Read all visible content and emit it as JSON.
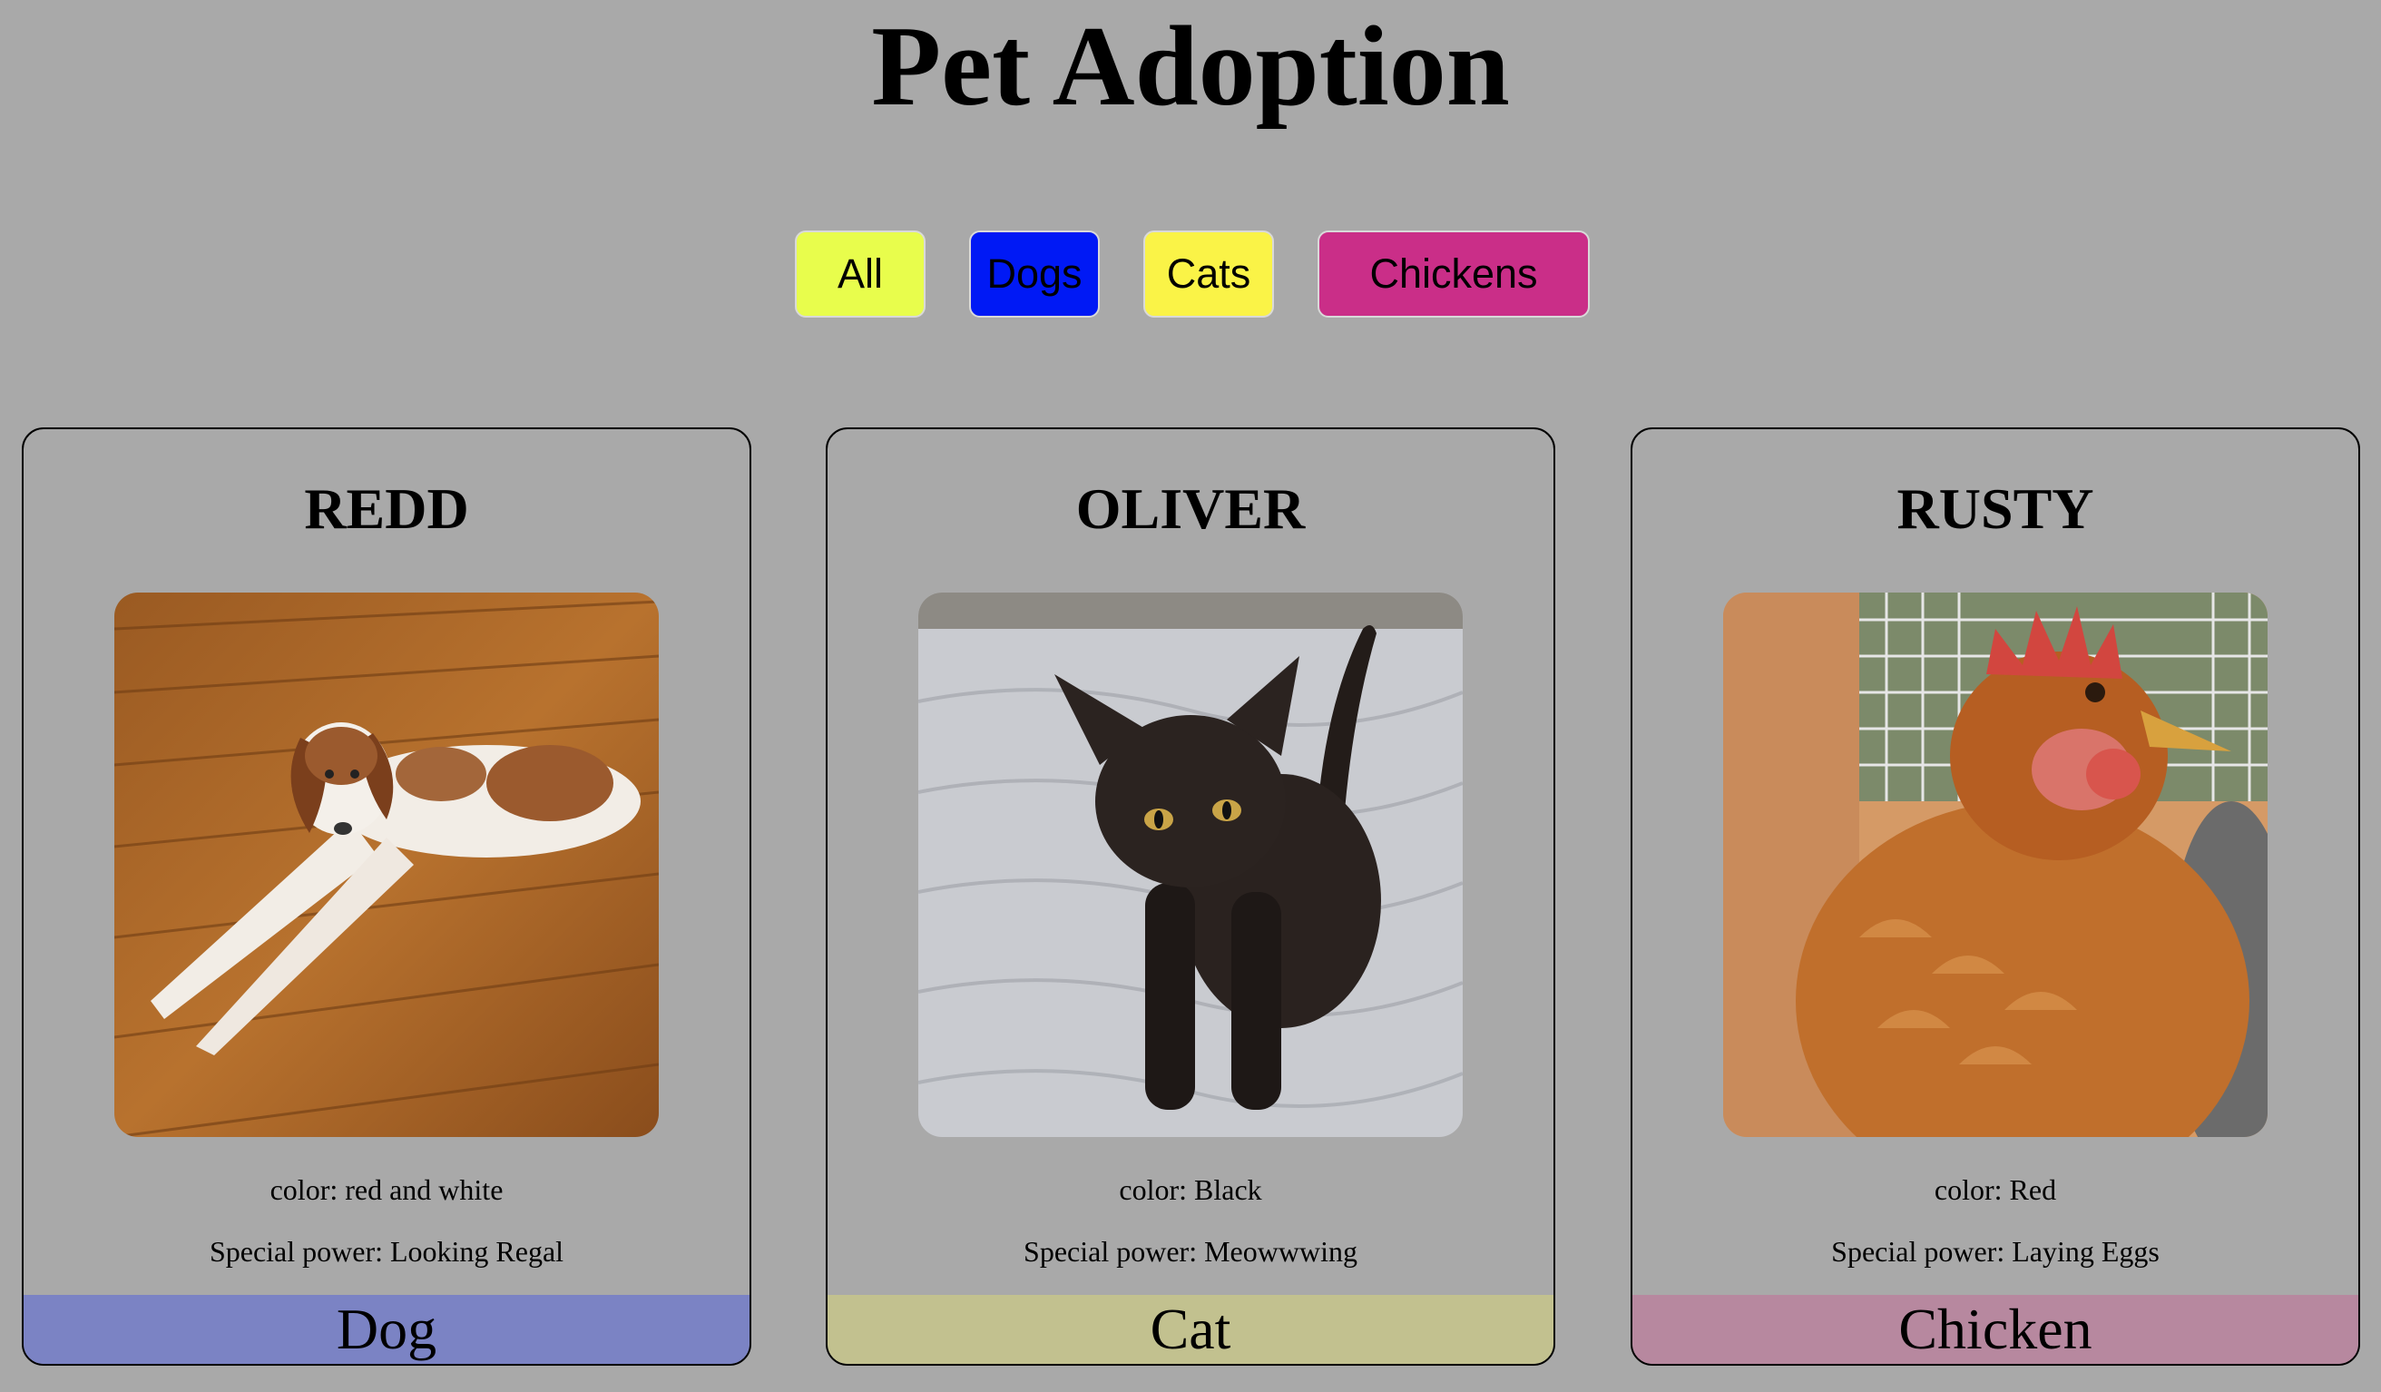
{
  "page": {
    "title": "Pet Adoption"
  },
  "filters": [
    {
      "label": "All",
      "color": "#e8fd4c"
    },
    {
      "label": "Dogs",
      "color": "#0019f5"
    },
    {
      "label": "Cats",
      "color": "#faf347"
    },
    {
      "label": "Chickens",
      "color": "#ca2e88"
    }
  ],
  "pets": [
    {
      "name": "REDD",
      "color_text": "color: red and white",
      "power_text": "Special power: Looking Regal",
      "type": "Dog",
      "type_color": "#7b83c4",
      "photo_icon": "dog-photo"
    },
    {
      "name": "OLIVER",
      "color_text": "color: Black",
      "power_text": "Special power: Meowwwing",
      "type": "Cat",
      "type_color": "#c2c18f",
      "photo_icon": "cat-photo"
    },
    {
      "name": "RUSTY",
      "color_text": "color: Red",
      "power_text": "Special power: Laying Eggs",
      "type": "Chicken",
      "type_color": "#b7889f",
      "photo_icon": "chicken-photo"
    }
  ]
}
